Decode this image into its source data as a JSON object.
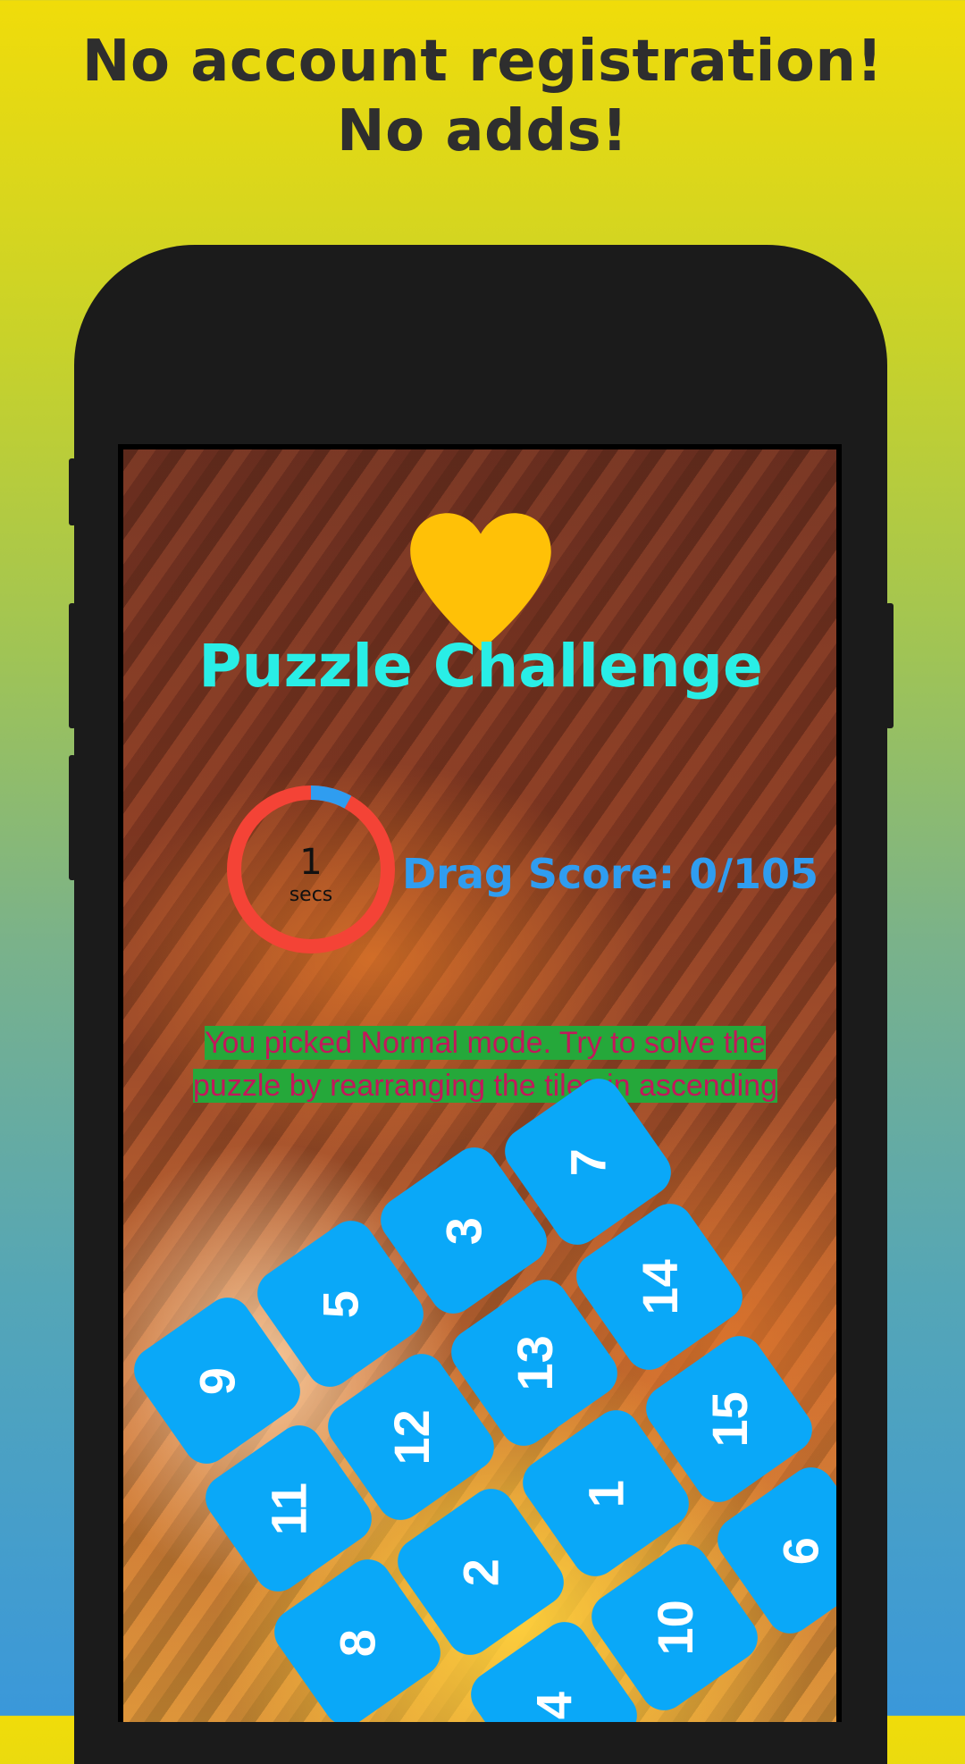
{
  "banner": {
    "headline": "No account registration! No adds!"
  },
  "app": {
    "title": "Puzzle Challenge",
    "timer": {
      "value": "1",
      "unit": "secs",
      "progress": 0.08
    },
    "score": {
      "label": "Drag Score: 0/105"
    },
    "message": "You picked Normal mode. Try to solve the puzzle by rearranging the tiles in ascending"
  },
  "tiles": [
    {
      "label": "7"
    },
    {
      "label": "3"
    },
    {
      "label": "14"
    },
    {
      "label": "5"
    },
    {
      "label": "13"
    },
    {
      "label": "15"
    },
    {
      "label": "9"
    },
    {
      "label": "12"
    },
    {
      "label": "1"
    },
    {
      "label": "6"
    },
    {
      "label": "11"
    },
    {
      "label": "2"
    },
    {
      "label": "10"
    },
    {
      "label": "8"
    },
    {
      "label": "4"
    }
  ],
  "colors": {
    "heart": "#ffc107",
    "title": "#29eee6",
    "score": "#2f9df0",
    "timer_ring": "#f44336",
    "timer_progress": "#2f9df0",
    "tile": "#0aa8f8",
    "message_text": "#c2185b",
    "message_bg": "#25a83a"
  },
  "icons": {
    "heart": "heart-icon"
  }
}
